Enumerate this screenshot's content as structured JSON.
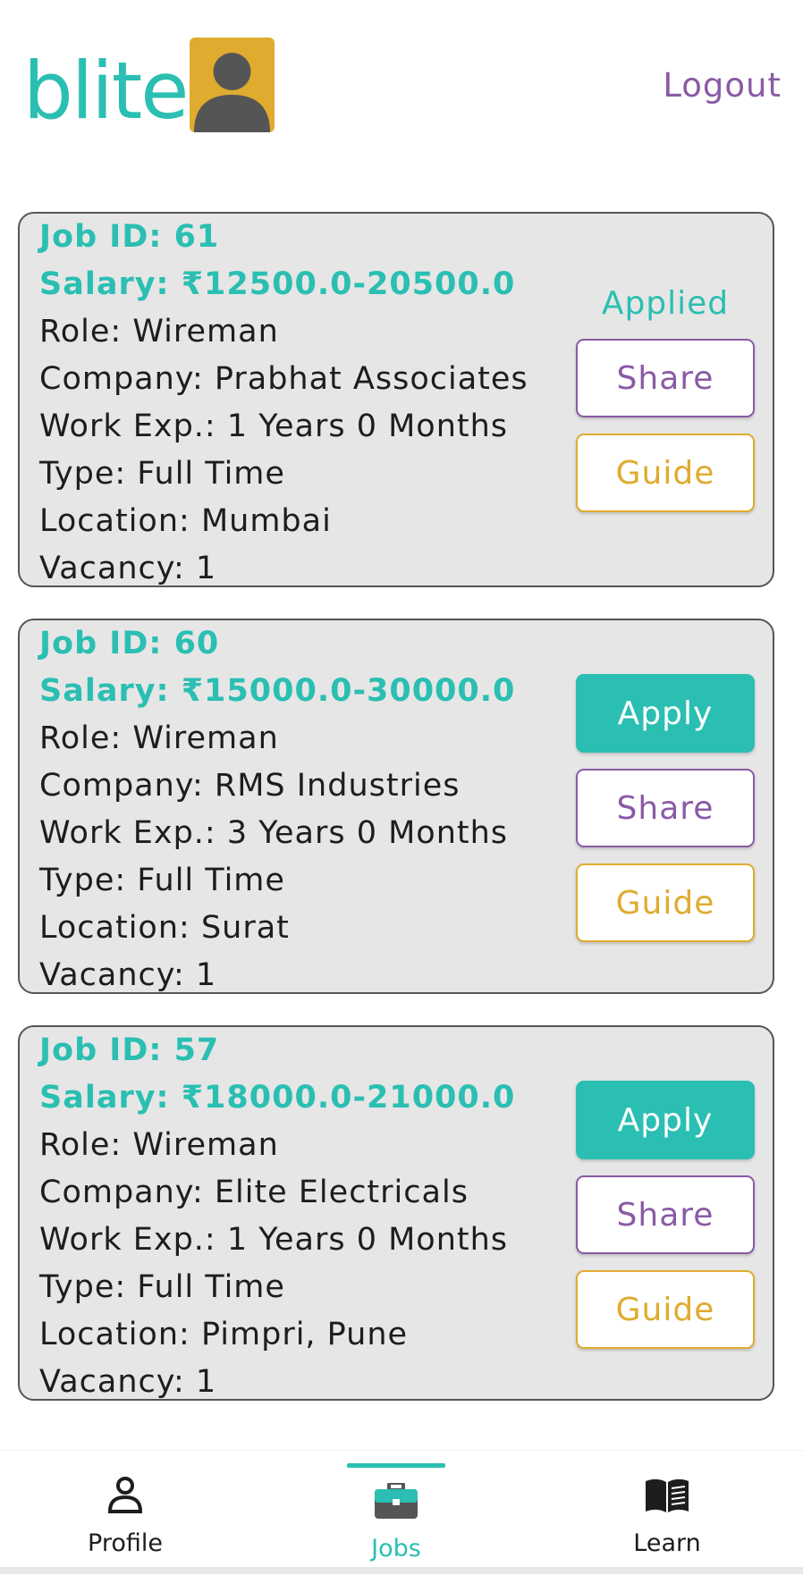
{
  "header": {
    "logo_text": "blite",
    "logout_label": "Logout"
  },
  "jobs": [
    {
      "job_id": "Job ID: 61",
      "salary": "Salary: ₹12500.0-20500.0",
      "role": "Role: Wireman",
      "company": "Company: Prabhat Associates",
      "work_exp": "Work Exp.: 1 Years 0 Months",
      "type": "Type: Full Time",
      "location": "Location: Mumbai",
      "vacancy": "Vacancy: 1",
      "status_label": "Applied",
      "share_label": "Share",
      "guide_label": "Guide"
    },
    {
      "job_id": "Job ID: 60",
      "salary": "Salary: ₹15000.0-30000.0",
      "role": "Role: Wireman",
      "company": "Company: RMS Industries",
      "work_exp": "Work Exp.: 3 Years 0 Months",
      "type": "Type: Full Time",
      "location": "Location: Surat",
      "vacancy": "Vacancy: 1",
      "apply_label": "Apply",
      "share_label": "Share",
      "guide_label": "Guide"
    },
    {
      "job_id": "Job ID: 57",
      "salary": "Salary: ₹18000.0-21000.0",
      "role": "Role: Wireman",
      "company": "Company: Elite Electricals",
      "work_exp": "Work Exp.: 1 Years 0 Months",
      "type": "Type: Full Time",
      "location": "Location: Pimpri, Pune",
      "vacancy": "Vacancy: 1",
      "apply_label": "Apply",
      "share_label": "Share",
      "guide_label": "Guide"
    }
  ],
  "bottom_nav": {
    "items": [
      {
        "label": "Profile",
        "icon": "person-icon"
      },
      {
        "label": "Jobs",
        "icon": "briefcase-icon",
        "active": true
      },
      {
        "label": "Learn",
        "icon": "book-icon"
      }
    ]
  },
  "colors": {
    "teal": "#2abfb2",
    "purple": "#8a5aa5",
    "gold": "#e0ab2e",
    "card_bg": "#e6e6e6"
  }
}
